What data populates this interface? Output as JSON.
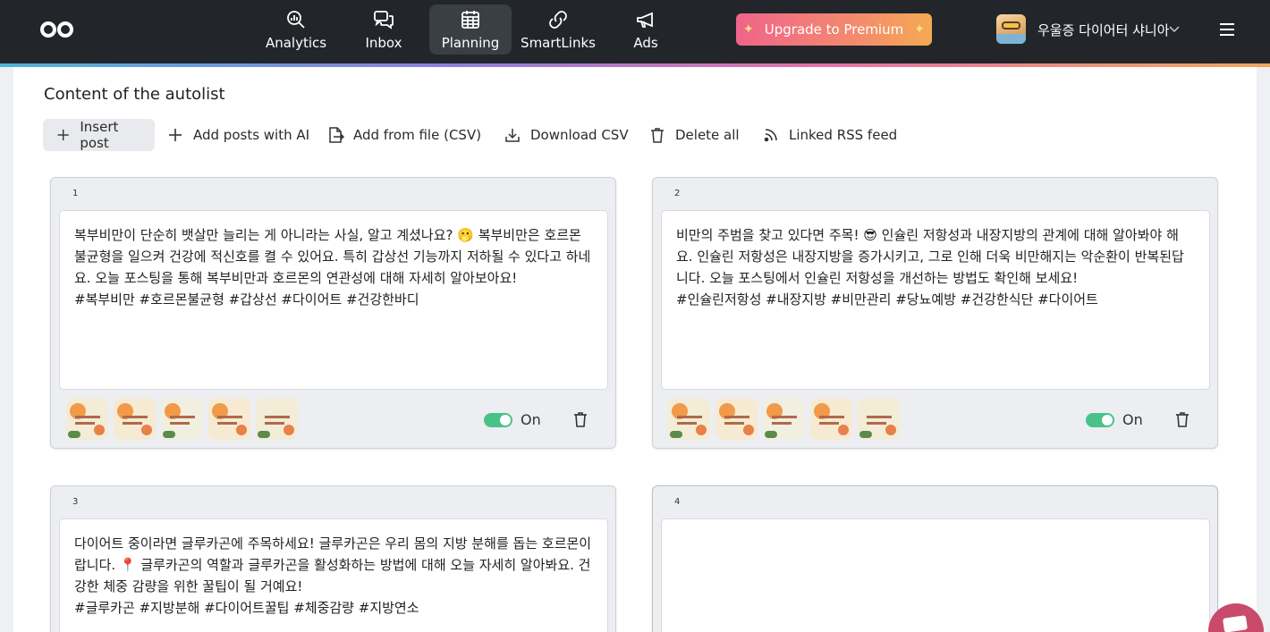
{
  "nav": {
    "items": [
      {
        "label": "Analytics",
        "icon": "analytics-icon"
      },
      {
        "label": "Inbox",
        "icon": "inbox-icon"
      },
      {
        "label": "Planning",
        "icon": "calendar-icon",
        "active": true
      },
      {
        "label": "SmartLinks",
        "icon": "link-icon"
      },
      {
        "label": "Ads",
        "icon": "megaphone-icon"
      }
    ],
    "upgrade_label": "Upgrade to Premium",
    "username": "우울증 다이어터 샤니아"
  },
  "content": {
    "title": "Content of the autolist",
    "toolbar": {
      "insert_post": "Insert post",
      "add_ai": "Add posts with AI",
      "add_file": "Add from file (CSV)",
      "download_csv": "Download CSV",
      "delete_all": "Delete all",
      "rss": "Linked RSS feed"
    },
    "posts": [
      {
        "number": "1",
        "text": "복부비만이 단순히 뱃살만 늘리는 게 아니라는 사실, 알고 계셨나요? 🫢 복부비만은 호르몬 불균형을 일으켜 건강에 적신호를 켤 수 있어요. 특히 갑상선 기능까지 저하될 수 있다고 하네요. 오늘 포스팅을 통해 복부비만과 호르몬의 연관성에 대해 자세히 알아보아요!\n#복부비만 #호르몬불균형 #갑상선 #다이어트 #건강한바디",
        "status": "On"
      },
      {
        "number": "2",
        "text": "비만의 주범을 찾고 있다면 주목! 😎 인슐린 저항성과 내장지방의 관계에 대해 알아봐야 해요. 인슐린 저항성은 내장지방을 증가시키고, 그로 인해 더욱 비만해지는 악순환이 반복된답니다. 오늘 포스팅에서 인슐린 저항성을 개선하는 방법도 확인해 보세요!\n#인슐린저항성 #내장지방 #비만관리 #당뇨예방 #건강한식단 #다이어트",
        "status": "On"
      },
      {
        "number": "3",
        "text": "다이어트 중이라면 글루카곤에 주목하세요! 글루카곤은 우리 몸의 지방 분해를 돕는 호르몬이랍니다. 📍 글루카곤의 역할과 글루카곤을 활성화하는 방법에 대해 오늘 자세히 알아봐요. 건강한 체중 감량을 위한 꿀팁이 될 거예요!\n#글루카곤 #지방분해 #다이어트꿀팁 #체중감량 #지방연소"
      },
      {
        "number": "4",
        "text": ""
      }
    ]
  }
}
